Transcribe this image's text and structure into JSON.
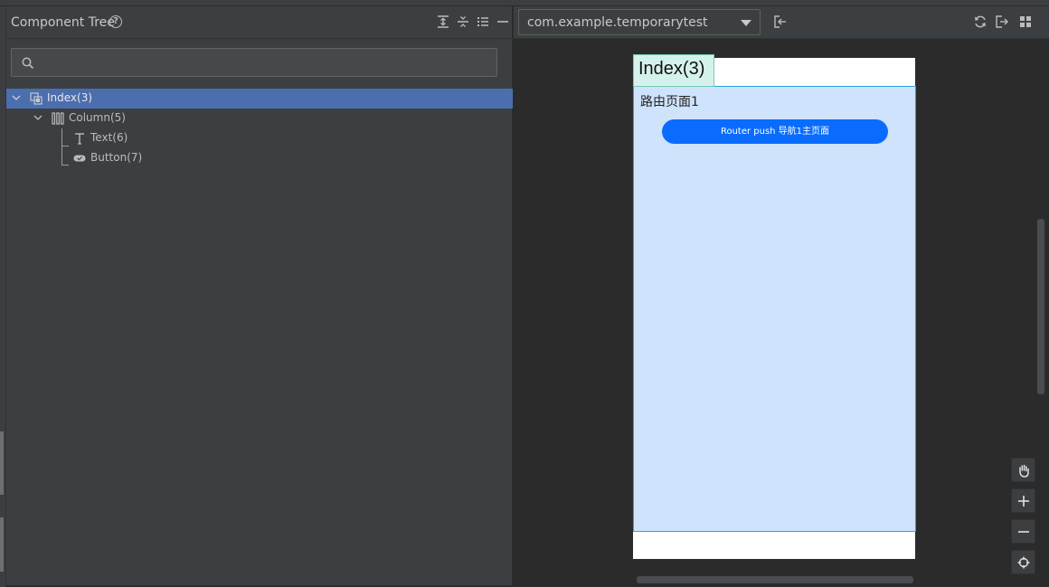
{
  "component_tree": {
    "title": "Component Tree",
    "help_glyph": "?",
    "search": {
      "value": "",
      "placeholder": ""
    },
    "nodes": [
      {
        "label": "Index(3)",
        "icon": "page-icon",
        "expanded": true,
        "selected": true
      },
      {
        "label": "Column(5)",
        "icon": "column-icon",
        "expanded": true,
        "selected": false
      },
      {
        "label": "Text(6)",
        "icon": "text-t-icon",
        "selected": false
      },
      {
        "label": "Button(7)",
        "icon": "button-pill-icon",
        "selected": false
      }
    ]
  },
  "preview": {
    "process_select": {
      "value": "com.example.temporarytest"
    },
    "index_label": "Index(3)",
    "page_text": "路由页面1",
    "router_button": "Router push 导航1主页面"
  },
  "colors": {
    "selection": "#4b6eaf",
    "column_highlight": "#cfe3fc",
    "index_label_bg": "#d4f2ec",
    "button_blue": "#0a6cff"
  }
}
